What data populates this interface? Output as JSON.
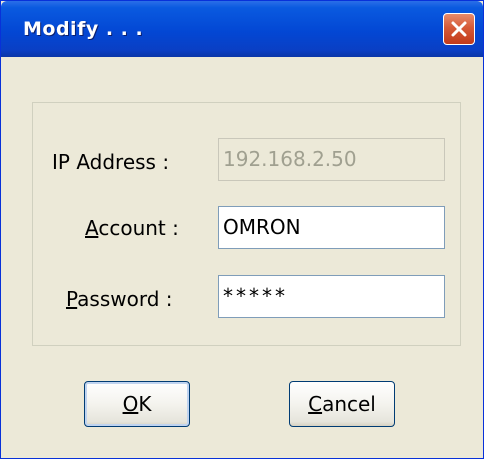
{
  "window": {
    "title": "Modify . . ."
  },
  "form": {
    "ip_label": "IP Address :",
    "ip_value": "192.168.2.50",
    "account_label_accel": "A",
    "account_label_rest": "ccount :",
    "account_value": "OMRON",
    "password_label_accel": "P",
    "password_label_rest": "assword :",
    "password_value": "*****"
  },
  "buttons": {
    "ok_accel": "O",
    "ok_rest": "K",
    "cancel_accel": "C",
    "cancel_rest": "ancel"
  },
  "colors": {
    "titlebar": "#0347d4",
    "dialog_bg": "#ece9d8",
    "close_button": "#d65a38"
  },
  "icons": {
    "close": "close-icon"
  }
}
